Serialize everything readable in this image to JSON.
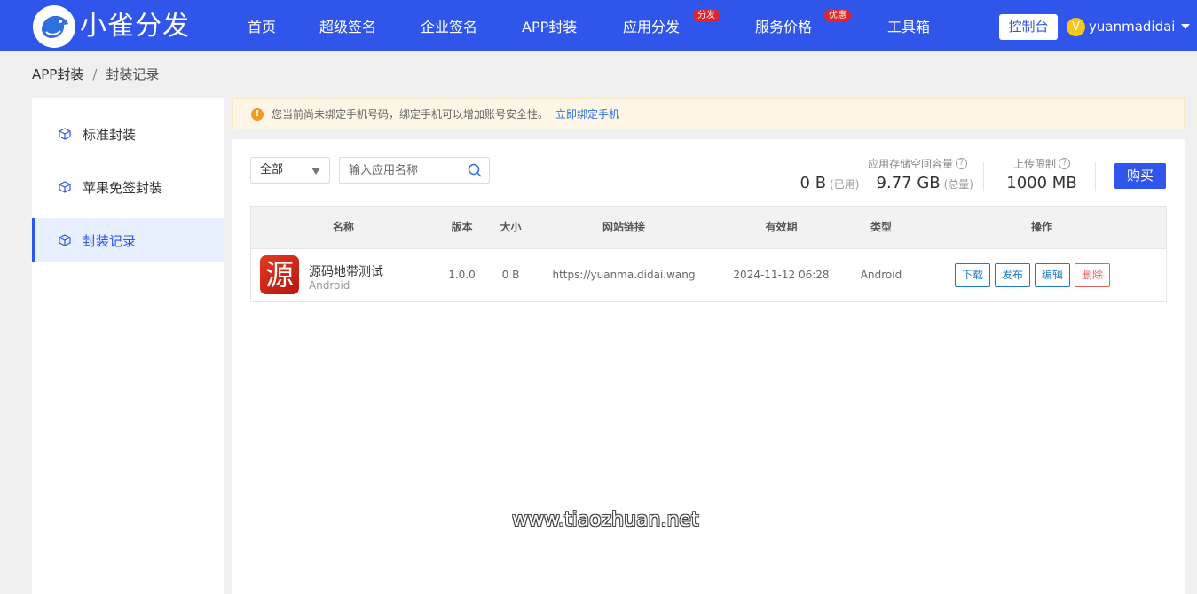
{
  "brand": {
    "name": "小雀分发",
    "logo_icon": "bird-logo-icon",
    "accent_color": "#2f55ea"
  },
  "nav": {
    "items": [
      {
        "label": "首页"
      },
      {
        "label": "超级签名"
      },
      {
        "label": "企业签名"
      },
      {
        "label": "APP封装"
      },
      {
        "label": "应用分发",
        "badge": "分发"
      },
      {
        "label": "服务价格",
        "badge": "优惠"
      },
      {
        "label": "工具箱"
      }
    ],
    "console_label": "控制台",
    "user": {
      "avatar_letter": "V",
      "name": "yuanmadidai"
    }
  },
  "breadcrumb": {
    "parent": "APP封装",
    "separator": "/",
    "current": "封装记录"
  },
  "sidebar": {
    "items": [
      {
        "label": "标准封装",
        "icon": "cube-icon"
      },
      {
        "label": "苹果免签封装",
        "icon": "cube-icon"
      },
      {
        "label": "封装记录",
        "icon": "cube-icon",
        "active": true
      }
    ]
  },
  "notice": {
    "text": "您当前尚未绑定手机号码，绑定手机可以增加账号安全性。",
    "link": "立即绑定手机",
    "icon_glyph": "!"
  },
  "filters": {
    "type_selected": "全部",
    "search_placeholder": "输入应用名称"
  },
  "storage": {
    "label": "应用存储空间容量",
    "used_value": "0 B",
    "used_suffix": "(已用)",
    "total_value": "9.77 GB",
    "total_suffix": "(总量)",
    "upload_label": "上传限制",
    "upload_value": "1000 MB",
    "help_glyph": "?",
    "buy_label": "购买"
  },
  "table": {
    "headers": {
      "name": "名称",
      "version": "版本",
      "size": "大小",
      "url": "网站链接",
      "expiry": "有效期",
      "type": "类型",
      "actions": "操作"
    },
    "rows": [
      {
        "icon_text": "源",
        "name": "源码地带测试",
        "platform": "Android",
        "version": "1.0.0",
        "size": "0 B",
        "url": "https://yuanma.didai.wang",
        "expiry": "2024-11-12 06:28",
        "type": "Android",
        "actions": {
          "download": "下载",
          "publish": "发布",
          "edit": "编辑",
          "delete": "删除"
        }
      }
    ]
  },
  "watermark": "www.tiaozhuan.net"
}
